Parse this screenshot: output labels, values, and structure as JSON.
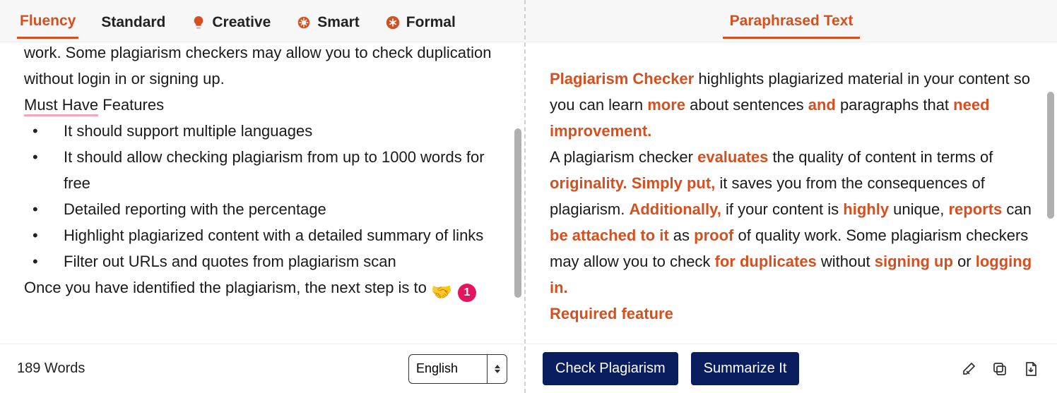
{
  "left": {
    "tabs": [
      {
        "label": "Fluency"
      },
      {
        "label": "Standard"
      },
      {
        "label": "Creative",
        "icon": "lightbulb"
      },
      {
        "label": "Smart",
        "icon": "gear-head"
      },
      {
        "label": "Formal",
        "icon": "asterisk"
      }
    ],
    "body": {
      "para_top": "attach the report with your content as supporting evidence of quality work. Some plagiarism checkers may allow you to check duplication without login in or signing up.",
      "must_have_u": "Must Have",
      "must_have_rest": " Features",
      "bullets": [
        "It should support multiple languages",
        "It should allow checking plagiarism from up to 1000 words for free",
        "Detailed reporting with the percentage",
        "Highlight plagiarized content with a detailed summary of links",
        "Filter out URLs and quotes from plagiarism scan"
      ],
      "para_bottom": "Once you have identified the plagiarism, the next step is to"
    },
    "footer": {
      "word_count": "189 Words",
      "language": "English"
    },
    "badge": {
      "emoji": "🤝",
      "count": "1"
    }
  },
  "right": {
    "tab_label": "Paraphrased Text",
    "tokens": [
      [
        "Plagiarism Checker ",
        true
      ],
      [
        "highlights plagiarized material in your content so you can learn ",
        false
      ],
      [
        "more ",
        true
      ],
      [
        "about sentences ",
        false
      ],
      [
        "and ",
        true
      ],
      [
        "paragraphs that ",
        false
      ],
      [
        "need improvement.",
        true
      ],
      [
        "\n",
        false
      ],
      [
        "A plagiarism checker ",
        false
      ],
      [
        "evaluates ",
        true
      ],
      [
        "the quality of content in terms of ",
        false
      ],
      [
        "originality. Simply put, ",
        true
      ],
      [
        "it saves you from the consequences of plagiarism. ",
        false
      ],
      [
        "Additionally, ",
        true
      ],
      [
        "if your content is ",
        false
      ],
      [
        "highly ",
        true
      ],
      [
        "unique, ",
        false
      ],
      [
        "reports ",
        true
      ],
      [
        "can ",
        false
      ],
      [
        "be attached to it ",
        true
      ],
      [
        "as ",
        false
      ],
      [
        "proof ",
        true
      ],
      [
        "of quality work. Some plagiarism checkers may allow you to check ",
        false
      ],
      [
        "for duplicates ",
        true
      ],
      [
        "without ",
        false
      ],
      [
        "signing up ",
        true
      ],
      [
        "or ",
        false
      ],
      [
        "logging in.",
        true
      ],
      [
        "\n",
        false
      ],
      [
        "Required feature",
        true
      ]
    ],
    "footer": {
      "check_label": "Check Plagiarism",
      "summarize_label": "Summarize It"
    }
  }
}
